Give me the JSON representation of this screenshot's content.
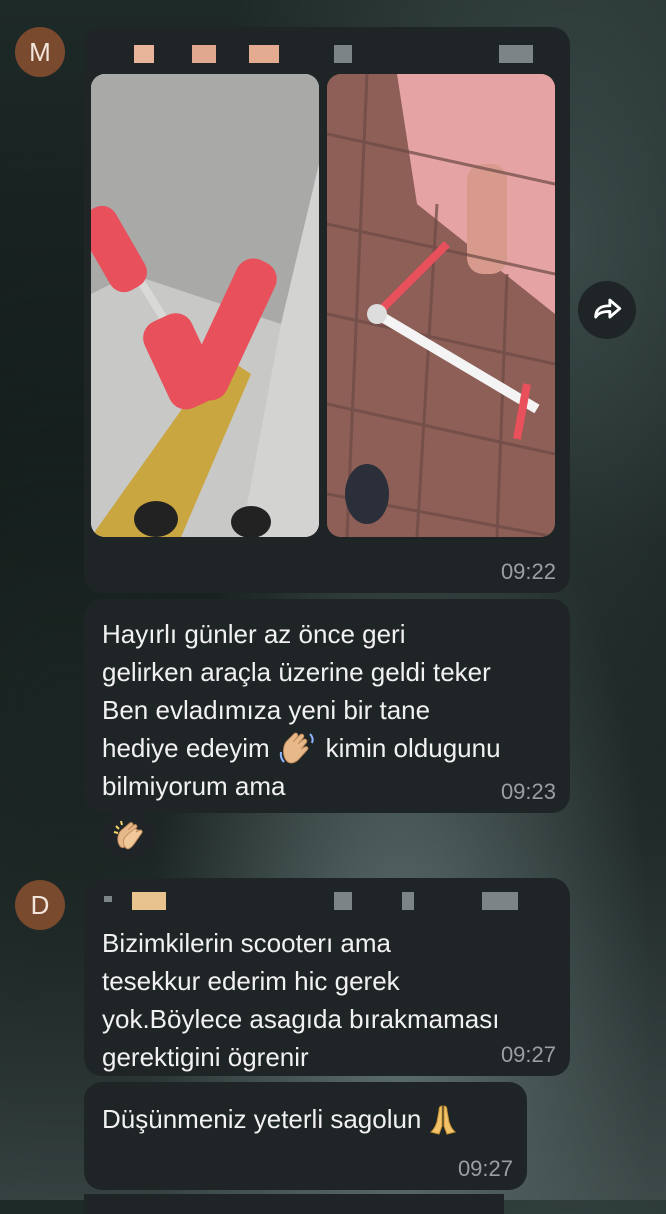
{
  "message1": {
    "avatar_letter": "M",
    "time": "09:22"
  },
  "message2": {
    "lines": [
      "Hayırlı günler az önce geri",
      "gelirken araçla üzerine geldi teker",
      "Ben evladımıza yeni bir tane",
      "hediye edeyim",
      "kimin oldugunu",
      "bilmiyorum  ama"
    ],
    "inline_emoji": "waving-hand",
    "time": "09:23",
    "reaction": "clapping-hands"
  },
  "message3": {
    "avatar_letter": "D",
    "lines": [
      "Bizimkilerin scooterı ama",
      "tesekkur ederim hic gerek",
      "yok.Böylece asagıda bırakmaması",
      "gerektigini ögrenir"
    ],
    "time": "09:27"
  },
  "message4": {
    "line": "Düşünmeniz yeterli sagolun",
    "emoji": "folded-hands",
    "time": "09:27"
  },
  "colors": {
    "bubble": "#1f2526",
    "avatar": "#7a4a2e",
    "time": "#9aa0a2",
    "text": "#f1f1f1",
    "scooter": "#e8505b"
  }
}
